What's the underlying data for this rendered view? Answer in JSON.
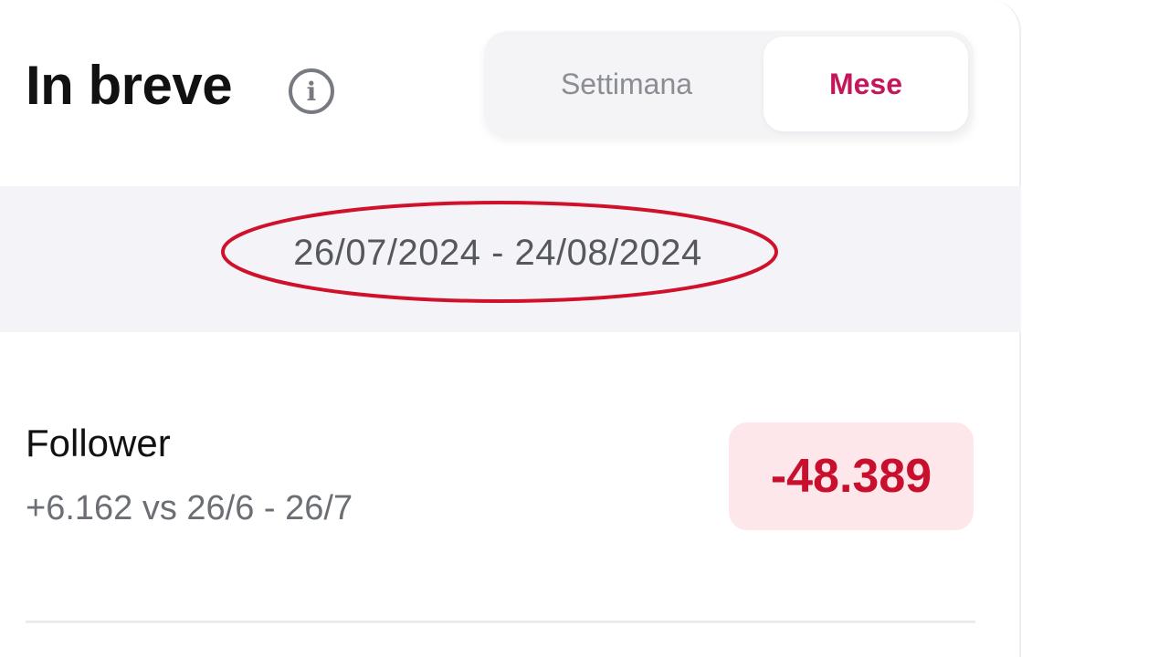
{
  "header": {
    "title": "In breve",
    "info_icon": "info-icon"
  },
  "period_toggle": {
    "options": [
      {
        "label": "Settimana",
        "selected": false
      },
      {
        "label": "Mese",
        "selected": true
      }
    ],
    "accent_color": "#c2185b"
  },
  "date_range": {
    "text": "26/07/2024 - 24/08/2024",
    "highlight_color": "#d0112b"
  },
  "metrics": [
    {
      "label": "Follower",
      "comparison": "+6.162 vs 26/6 - 26/7",
      "value": "-48.389",
      "value_color": "#c8102e",
      "badge_color": "#fde7ea"
    }
  ]
}
